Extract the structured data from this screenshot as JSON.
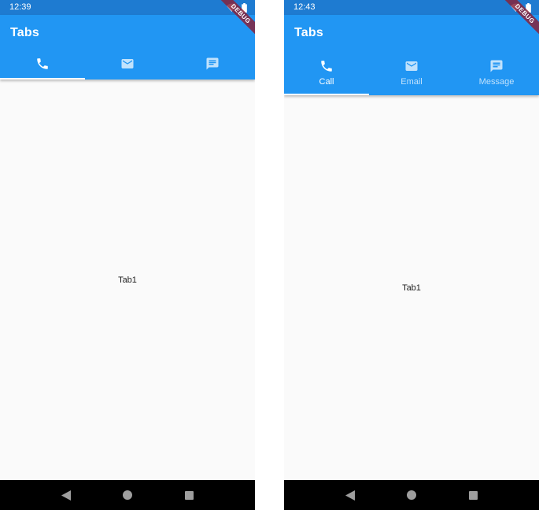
{
  "left": {
    "status_time": "12:39",
    "app_title": "Tabs",
    "tabs": [
      {
        "icon": "phone-icon",
        "label": "",
        "active": true
      },
      {
        "icon": "email-icon",
        "label": "",
        "active": false
      },
      {
        "icon": "message-icon",
        "label": "",
        "active": false
      }
    ],
    "content_text": "Tab1",
    "debug_banner": "DEBUG"
  },
  "right": {
    "status_time": "12:43",
    "app_title": "Tabs",
    "tabs": [
      {
        "icon": "phone-icon",
        "label": "Call",
        "active": true
      },
      {
        "icon": "email-icon",
        "label": "Email",
        "active": false
      },
      {
        "icon": "message-icon",
        "label": "Message",
        "active": false
      }
    ],
    "content_text": "Tab1",
    "debug_banner": "DEBUG"
  },
  "colors": {
    "status_bar": "#1e7bd1",
    "app_bar": "#2196f3",
    "background": "#fafafa",
    "nav_bar": "#000000",
    "debug_banner": "#86233c"
  }
}
